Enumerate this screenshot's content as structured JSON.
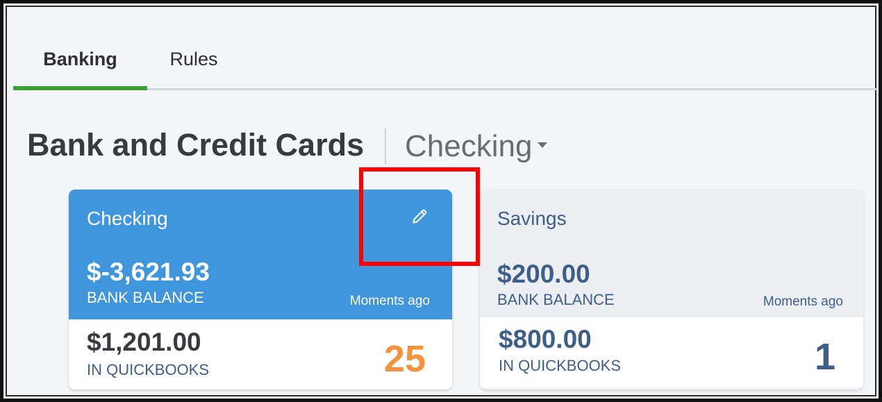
{
  "tabs": [
    {
      "label": "Banking",
      "active": true
    },
    {
      "label": "Rules",
      "active": false
    }
  ],
  "header": {
    "title": "Bank and Credit Cards",
    "selected_account": "Checking"
  },
  "accounts": [
    {
      "name": "Checking",
      "bank_balance": "$-3,621.93",
      "bank_balance_label": "BANK BALANCE",
      "updated": "Moments ago",
      "quickbooks_balance": "$1,201.00",
      "quickbooks_label": "IN QUICKBOOKS",
      "pending_count": "25",
      "selected": true
    },
    {
      "name": "Savings",
      "bank_balance": "$200.00",
      "bank_balance_label": "BANK BALANCE",
      "updated": "Moments ago",
      "quickbooks_balance": "$800.00",
      "quickbooks_label": "IN QUICKBOOKS",
      "pending_count": "1",
      "selected": false
    }
  ],
  "icons": {
    "edit": "pencil-icon",
    "dropdown": "caret-down-icon"
  },
  "colors": {
    "active_tab": "#3d9e37",
    "selected_card": "#4096dd",
    "highlight": "#ff0000",
    "pending_count": "#f1943d"
  }
}
